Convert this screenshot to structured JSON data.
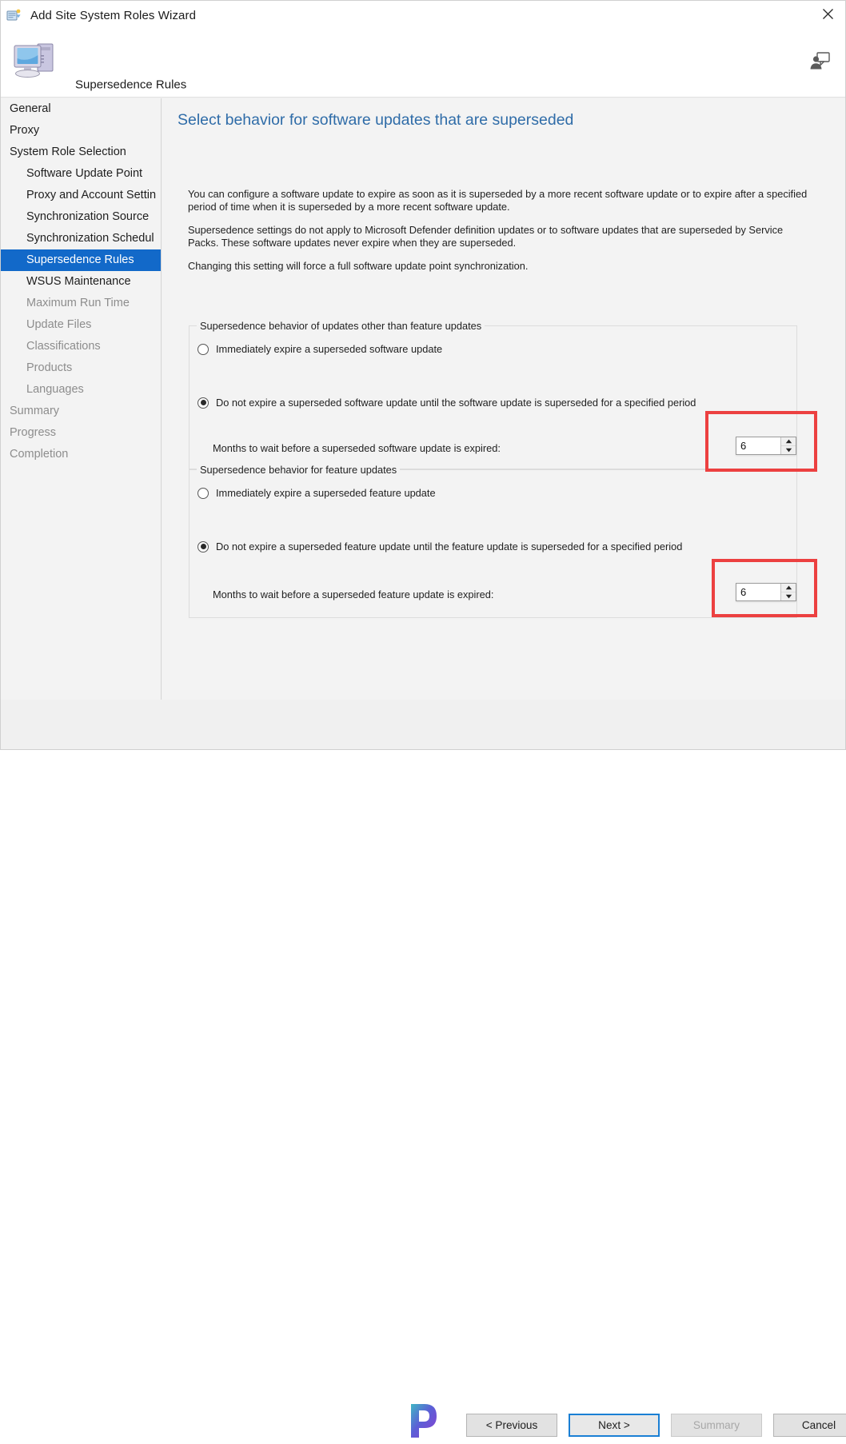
{
  "window": {
    "title": "Add Site System Roles Wizard",
    "title_icon": "wizard-icon",
    "close_icon": "close-icon",
    "subtitle": "Supersedence Rules",
    "banner_icon": "computer-icon",
    "feedback_icon": "feedback-person-icon"
  },
  "sidebar": {
    "items": [
      {
        "label": "General",
        "indent": false,
        "state": "normal"
      },
      {
        "label": "Proxy",
        "indent": false,
        "state": "normal"
      },
      {
        "label": "System Role Selection",
        "indent": false,
        "state": "normal"
      },
      {
        "label": "Software Update Point",
        "indent": true,
        "state": "normal"
      },
      {
        "label": "Proxy and Account Settin",
        "indent": true,
        "state": "normal"
      },
      {
        "label": "Synchronization Source",
        "indent": true,
        "state": "normal"
      },
      {
        "label": "Synchronization Schedul",
        "indent": true,
        "state": "normal"
      },
      {
        "label": "Supersedence Rules",
        "indent": true,
        "state": "selected"
      },
      {
        "label": "WSUS Maintenance",
        "indent": true,
        "state": "normal"
      },
      {
        "label": "Maximum Run Time",
        "indent": true,
        "state": "dim"
      },
      {
        "label": "Update Files",
        "indent": true,
        "state": "dim"
      },
      {
        "label": "Classifications",
        "indent": true,
        "state": "dim"
      },
      {
        "label": "Products",
        "indent": true,
        "state": "dim"
      },
      {
        "label": "Languages",
        "indent": true,
        "state": "dim"
      },
      {
        "label": "Summary",
        "indent": false,
        "state": "dim"
      },
      {
        "label": "Progress",
        "indent": false,
        "state": "dim"
      },
      {
        "label": "Completion",
        "indent": false,
        "state": "dim"
      }
    ],
    "scrollbar": {
      "left_arrow": "‹",
      "right_arrow": "›"
    }
  },
  "main": {
    "heading": "Select behavior for software updates that are superseded",
    "paragraphs": [
      "You can configure a software update to expire as soon as it is superseded by a more recent software update or to expire after a specified period of time when it is superseded by a more recent software update.",
      "Supersedence settings do not apply to Microsoft Defender definition updates or to software updates that are superseded by Service Packs. These software updates never expire when they are superseded.",
      "Changing this setting will force a full software update point synchronization."
    ],
    "groups": [
      {
        "legend": "Supersedence behavior of updates other than feature updates",
        "option_immediate": "Immediately expire a superseded software update",
        "option_immediate_selected": false,
        "option_delay": "Do not expire a superseded software update until the software update is superseded for a specified period",
        "option_delay_selected": true,
        "months_label": "Months to wait before a superseded software update is expired:",
        "months_value": "6",
        "spin_up": "▲",
        "spin_down": "▼"
      },
      {
        "legend": "Supersedence behavior for feature updates",
        "option_immediate": "Immediately expire a superseded feature update",
        "option_immediate_selected": false,
        "option_delay": "Do not expire a superseded feature update until the feature update is superseded for a specified period",
        "option_delay_selected": true,
        "months_label": "Months to wait before a superseded feature update is expired:",
        "months_value": "6",
        "spin_up": "▲",
        "spin_down": "▼"
      }
    ]
  },
  "footer": {
    "previous": "< Previous",
    "next": "Next >",
    "summary": "Summary",
    "cancel": "Cancel",
    "watermark": "prajwal-logo"
  },
  "colors": {
    "accent_heading": "#2f6ca8",
    "selection": "#1269c9",
    "annotation": "#ec4040",
    "focus_border": "#1a7fd4",
    "window_bg": "#f0f0f0",
    "panel_bg": "#f3f3f3"
  }
}
